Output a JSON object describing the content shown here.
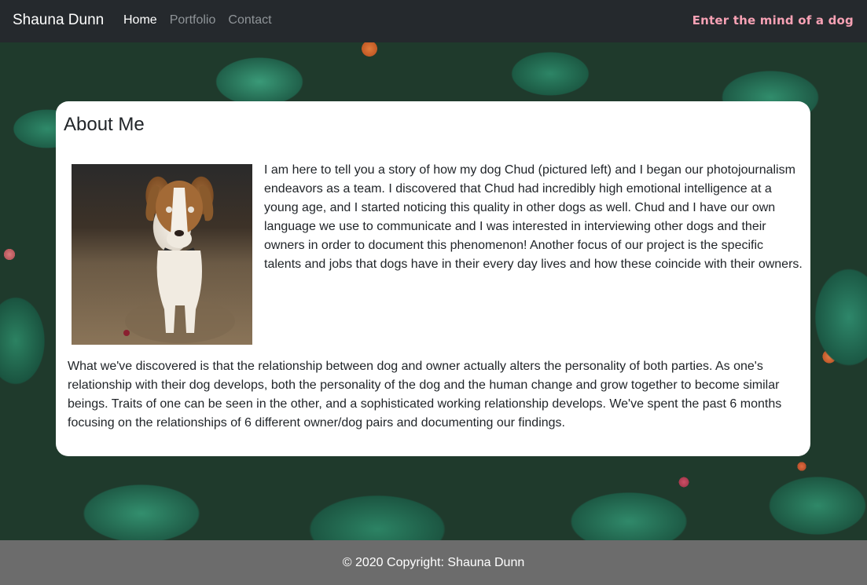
{
  "navbar": {
    "brand": "Shauna Dunn",
    "links": [
      {
        "label": "Home",
        "active": true
      },
      {
        "label": "Portfolio",
        "active": false
      },
      {
        "label": "Contact",
        "active": false
      }
    ],
    "tagline": "Enter the mind of a dog"
  },
  "about": {
    "title": "About Me",
    "photo_alt": "Chud the dog",
    "paragraph1": "I am here to tell you a story of how my dog Chud (pictured left) and I began our photojournalism endeavors as a team. I discovered that Chud had incredibly high emotional intelligence at a young age, and I started noticing this quality in other dogs as well. Chud and I have our own language we use to communicate and I was interested in interviewing other dogs and their owners in order to document this phenomenon! Another focus of our project is the specific talents and jobs that dogs have in their every day lives and how these coincide with their owners.",
    "paragraph2": "What we've discovered is that the relationship between dog and owner actually alters the personality of both parties. As one's relationship with their dog develops, both the personality of the dog and the human change and grow together to become similar beings. Traits of one can be seen in the other, and a sophisticated working relationship develops. We've spent the past 6 months focusing on the relationships of 6 different owner/dog pairs and documenting our findings."
  },
  "footer": {
    "copyright": "© 2020 Copyright: Shauna Dunn"
  },
  "colors": {
    "navbar_bg": "#25292d",
    "tagline": "#f6a1b4",
    "footer_bg": "#6c6c6c",
    "card_bg": "#ffffff"
  }
}
